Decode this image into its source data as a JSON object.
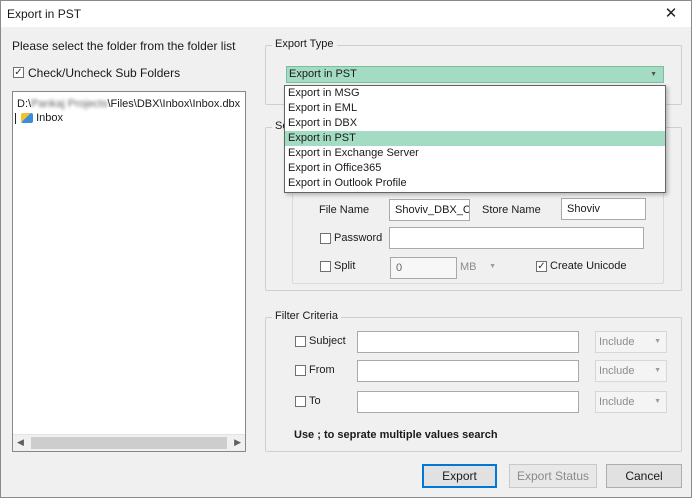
{
  "window": {
    "title": "Export in PST"
  },
  "left": {
    "instruction": "Please select the folder from the folder list",
    "subfolder_checkbox_label": "Check/Uncheck Sub Folders",
    "tree": {
      "root_prefix": "D:\\",
      "root_blurred": "Pankaj Projects",
      "root_suffix": "\\Files\\DBX\\Inbox\\Inbox.dbx",
      "child_label": "Inbox"
    }
  },
  "export_type": {
    "group_title": "Export Type",
    "selected": "Export in PST",
    "options": [
      "Export in MSG",
      "Export in EML",
      "Export in DBX",
      "Export in PST",
      "Export in Exchange Server",
      "Export in Office365",
      "Export in Outlook Profile"
    ],
    "selected_index": 3
  },
  "settings": {
    "group_title_visible": "Se",
    "file_name_label": "File Name",
    "file_name_value": "Shoviv_DBX_Co",
    "store_name_label": "Store Name",
    "store_name_value": "Shoviv",
    "password_label": "Password",
    "password_value": "",
    "split_label": "Split",
    "split_value": "0",
    "split_unit": "MB",
    "unicode_label": "Create Unicode"
  },
  "filter": {
    "group_title": "Filter Criteria",
    "rows": [
      {
        "label": "Subject",
        "value": "",
        "mode": "Include"
      },
      {
        "label": "From",
        "value": "",
        "mode": "Include"
      },
      {
        "label": "To",
        "value": "",
        "mode": "Include"
      }
    ],
    "hint": "Use ; to seprate multiple values search"
  },
  "buttons": {
    "export": "Export",
    "export_status": "Export Status",
    "cancel": "Cancel"
  },
  "colors": {
    "selection": "#a3dcc3",
    "default_button_border": "#0078d7"
  }
}
